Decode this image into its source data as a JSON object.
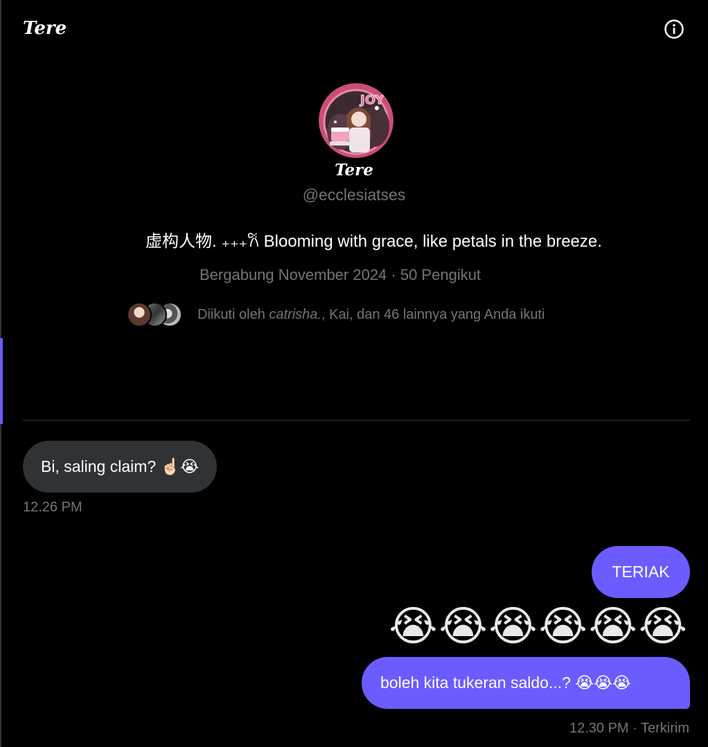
{
  "header": {
    "title": "Tere",
    "info_icon": "info-icon"
  },
  "profile": {
    "name": "Tere",
    "handle": "@ecclesiatses",
    "bio": "虚构人物. ₊₊₊𐙚 Blooming with grace, like petals in the breeze.",
    "meta": "Bergabung November 2024 · 50 Pengikut",
    "followed_prefix": "Diikuti oleh ",
    "followed_name": "catrisha.",
    "followed_suffix": ", Kai, dan 46 lainnya yang Anda ikuti",
    "avatar_text": "JOY"
  },
  "messages": {
    "received": {
      "text": "Bi, saling claim? ☝🏻😭",
      "time": "12.26 PM"
    },
    "sent": [
      {
        "text": "TERIAK"
      },
      {
        "text": "😭😭😭😭😭😭"
      },
      {
        "text": "boleh kita tukeran saldo...? 😭😭😭"
      }
    ],
    "sent_status": "12.30 PM · Terkirim"
  },
  "colors": {
    "background": "#000000",
    "sent_bubble": "#6a5cff",
    "received_bubble": "#2f3336",
    "muted_text": "#71767b",
    "accent": "#6a5cff"
  }
}
